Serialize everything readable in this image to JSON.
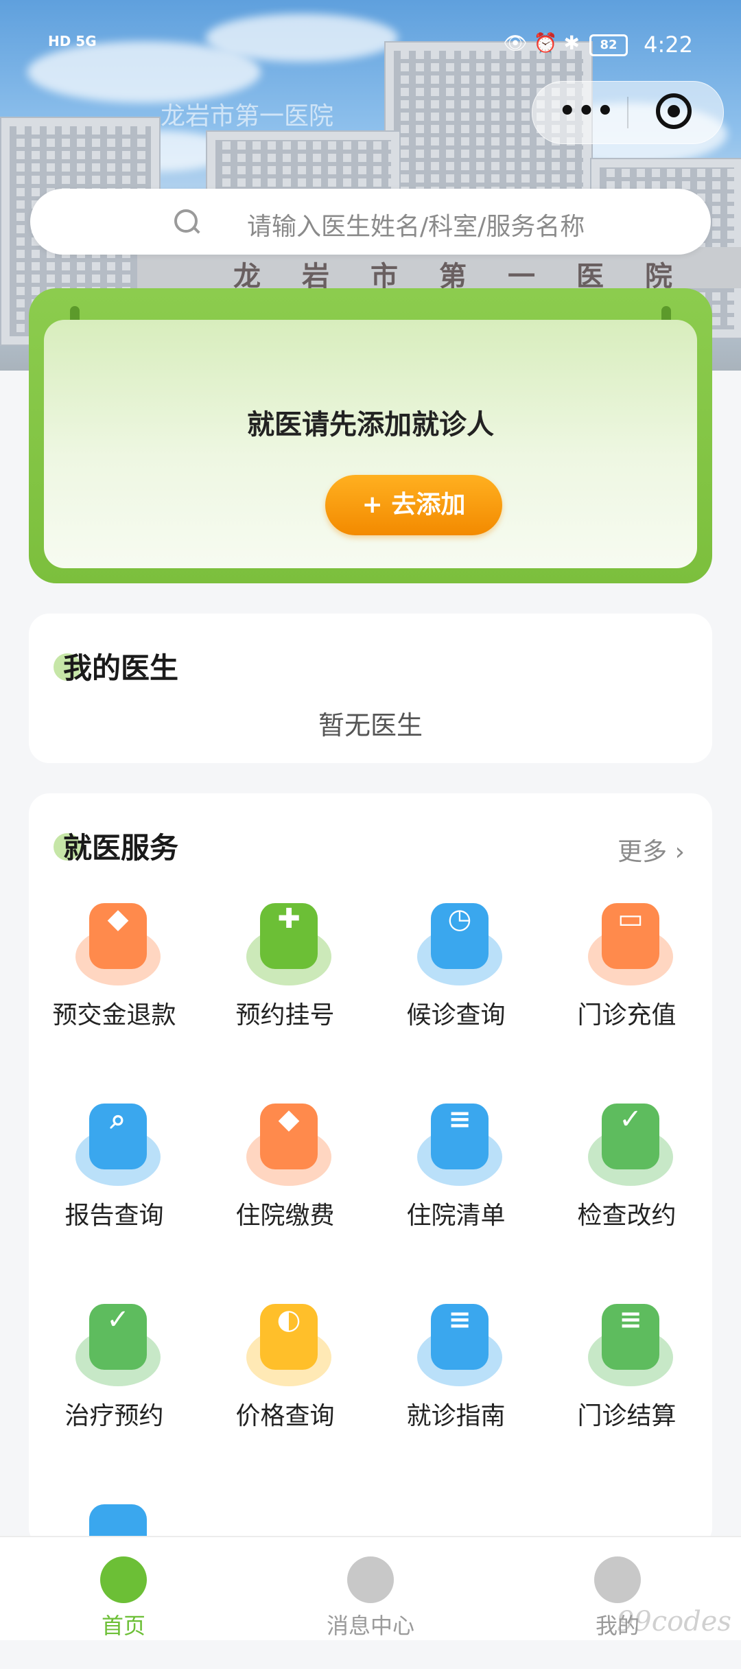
{
  "status_bar": {
    "left_text": "HD 5G",
    "icons": "👁 ⏰ ✱",
    "battery": "82",
    "time": "4:22"
  },
  "miniprogram": {
    "title": "龙岩市第一医院",
    "menu_label": "•••"
  },
  "hero": {
    "sign_text": "龙岩市第一医院"
  },
  "search": {
    "placeholder": "请输入医生姓名/科室/服务名称"
  },
  "patient_card": {
    "message": "就医请先添加就诊人",
    "add_button": "+ 去添加"
  },
  "my_doctor": {
    "title": "我的医生",
    "empty_text": "暂无医生"
  },
  "services": {
    "title": "就医服务",
    "more": "更多 ›",
    "items": [
      {
        "label": "预交金退款",
        "icon": "money-bag-icon",
        "color": "#ff8a4c",
        "glyph": "◆"
      },
      {
        "label": "预约挂号",
        "icon": "cross-badge-icon",
        "color": "#6cbf36",
        "glyph": "✚"
      },
      {
        "label": "候诊查询",
        "icon": "chair-icon",
        "color": "#3aa7ee",
        "glyph": "◷"
      },
      {
        "label": "门诊充值",
        "icon": "wallet-icon",
        "color": "#ff8a4c",
        "glyph": "▭"
      },
      {
        "label": "报告查询",
        "icon": "clipboard-search-icon",
        "color": "#3aa7ee",
        "glyph": "⌕"
      },
      {
        "label": "住院缴费",
        "icon": "money-bag-icon",
        "color": "#ff8a4c",
        "glyph": "◆"
      },
      {
        "label": "住院清单",
        "icon": "ticket-icon",
        "color": "#3aa7ee",
        "glyph": "≡"
      },
      {
        "label": "检查改约",
        "icon": "exam-calendar-icon",
        "color": "#5ebc5e",
        "glyph": "✓"
      },
      {
        "label": "治疗预约",
        "icon": "treatment-calendar-icon",
        "color": "#5ebc5e",
        "glyph": "✓"
      },
      {
        "label": "价格查询",
        "icon": "price-tag-icon",
        "color": "#ffbf2a",
        "glyph": "◐"
      },
      {
        "label": "就诊指南",
        "icon": "guide-book-icon",
        "color": "#3aa7ee",
        "glyph": "≡"
      },
      {
        "label": "门诊结算",
        "icon": "receipt-icon",
        "color": "#5ebc5e",
        "glyph": "≡"
      },
      {
        "label": "",
        "icon": "guide-book-icon",
        "color": "#3aa7ee",
        "glyph": ""
      }
    ]
  },
  "tabbar": {
    "items": [
      {
        "label": "首页",
        "icon": "home-icon",
        "active": true,
        "color": "#6cbf36"
      },
      {
        "label": "消息中心",
        "icon": "message-icon",
        "active": false,
        "color": "#c8c8c8"
      },
      {
        "label": "我的",
        "icon": "profile-icon",
        "active": false,
        "color": "#c8c8c8"
      }
    ],
    "active_color": "#6cbf36",
    "inactive_color": "#9a9a9a"
  },
  "watermark": "99codes"
}
